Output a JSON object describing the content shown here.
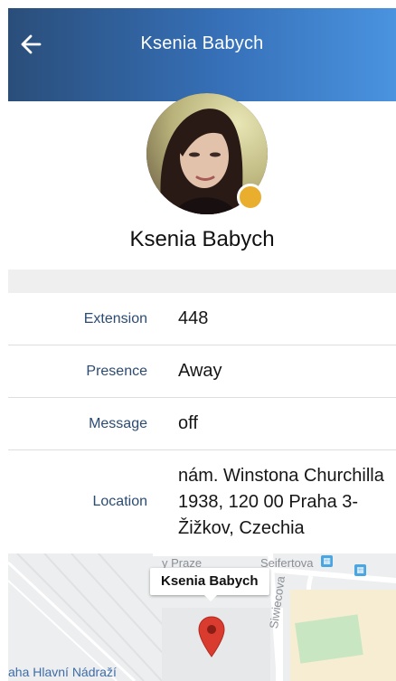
{
  "header": {
    "title": "Ksenia Babych",
    "back_icon": "arrow-left-icon"
  },
  "profile": {
    "name": "Ksenia Babych",
    "presence_color": "#e9ae2e"
  },
  "details": [
    {
      "label": "Extension",
      "value": "448"
    },
    {
      "label": "Presence",
      "value": "Away"
    },
    {
      "label": "Message",
      "value": "off"
    },
    {
      "label": "Location",
      "value": "nám. Winstona Churchilla 1938, 120 00 Praha 3-Žižkov, Czechia"
    }
  ],
  "map": {
    "marker_label": "Ksenia Babych",
    "streets": [
      "Seifertova",
      "Siwiecova",
      "y Praze"
    ],
    "station": "aha Hlavní Nádraží",
    "pin_color": "#d93b2f",
    "transit_icon": "rail-station-icon"
  },
  "colors": {
    "header_start": "#2a4e7a",
    "header_end": "#4a93df",
    "label_color": "#2b4b72"
  }
}
